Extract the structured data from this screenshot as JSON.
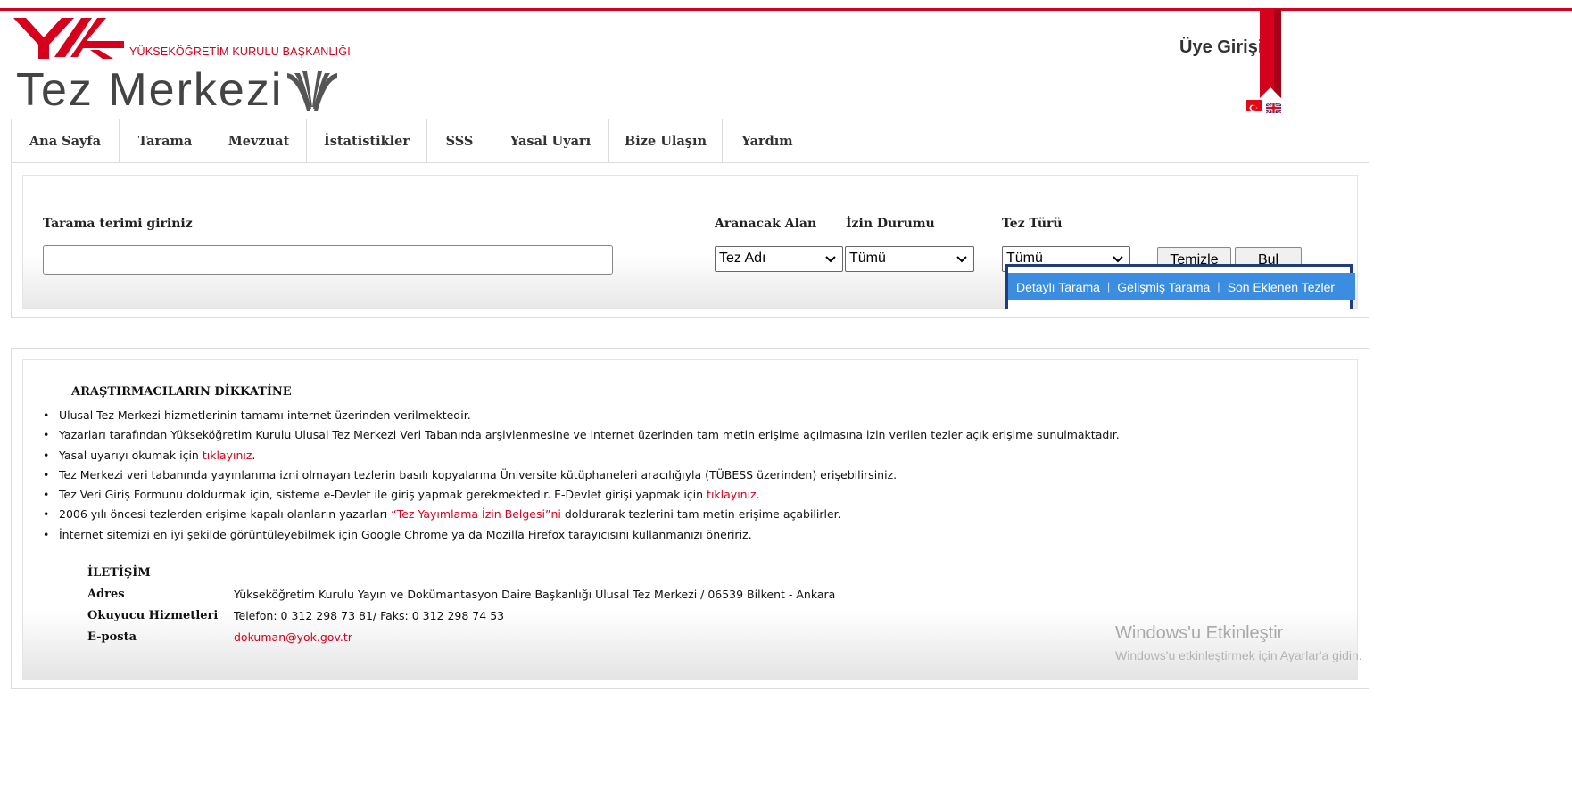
{
  "header": {
    "org_name": "YÜKSEKÖĞRETİM KURULU BAŞKANLIĞI",
    "site_title": "Tez Merkezi",
    "member_login": "Üye Girişi",
    "brand_color": "#d6001c"
  },
  "nav": {
    "items": [
      {
        "label": "Ana Sayfa"
      },
      {
        "label": "Tarama"
      },
      {
        "label": "Mevzuat"
      },
      {
        "label": "İstatistikler"
      },
      {
        "label": "SSS"
      },
      {
        "label": "Yasal Uyarı"
      },
      {
        "label": "Bize Ulaşın"
      },
      {
        "label": "Yardım"
      }
    ]
  },
  "search": {
    "term_label": "Tarama terimi giriniz",
    "term_value": "",
    "field_label": "Aranacak Alan",
    "field_value": "Tez Adı",
    "permission_label": "İzin Durumu",
    "permission_value": "Tümü",
    "type_label": "Tez Türü",
    "type_value": "Tümü",
    "clear_label": "Temizle",
    "find_label": "Bul",
    "tabs": [
      {
        "label": "Detaylı Tarama"
      },
      {
        "label": "Gelişmiş Tarama"
      },
      {
        "label": "Son Eklenen Tezler"
      }
    ],
    "tab_color": "#3b8de2"
  },
  "info": {
    "title": "ARAŞTIRMACILARIN DİKKATİNE",
    "bullets": [
      {
        "text": "Ulusal Tez Merkezi hizmetlerinin tamamı internet üzerinden verilmektedir."
      },
      {
        "text": "Yazarları tarafından Yükseköğretim Kurulu Ulusal Tez Merkezi Veri Tabanında arşivlenmesine ve internet üzerinden tam metin erişime açılmasına izin verilen tezler açık erişime sunulmaktadır."
      },
      {
        "pre": "Yasal uyarıyı okumak için ",
        "link": "tıklayınız",
        "post": "."
      },
      {
        "text": "Tez Merkezi veri tabanında yayınlanma izni olmayan tezlerin basılı kopyalarına Üniversite kütüphaneleri aracılığıyla (TÜBESS üzerinden) erişebilirsiniz."
      },
      {
        "pre": "Tez Veri Giriş Formunu doldurmak için, sisteme e-Devlet ile giriş yapmak gerekmektedir. E-Devlet girişi yapmak için ",
        "link": "tıklayınız",
        "post": "."
      },
      {
        "pre": "2006 yılı öncesi tezlerden erişime kapalı olanların yazarları ",
        "link": "“Tez Yayımlama İzin Belgesi”ni",
        "post": " doldurarak tezlerini tam metin erişime açabilirler."
      },
      {
        "text": "İnternet sitemizi en iyi şekilde görüntüleyebilmek için Google Chrome ya da Mozilla Firefox tarayıcısını kullanmanızı öneririz."
      }
    ]
  },
  "contact": {
    "title": "İLETİŞİM",
    "address_label": "Adres",
    "address_value": "Yükseköğretim Kurulu Yayın ve Dokümantasyon Daire Başkanlığı Ulusal Tez Merkezi / 06539 Bilkent - Ankara",
    "reader_label": "Okuyucu Hizmetleri",
    "reader_value": "Telefon: 0 312 298 73 81/ Faks: 0 312 298 74 53",
    "email_label": "E-posta",
    "email_value": "dokuman@yok.gov.tr"
  },
  "watermark": {
    "title": "Windows'u Etkinleştir",
    "subtitle": "Windows'u etkinleştirmek için Ayarlar'a gidin."
  }
}
